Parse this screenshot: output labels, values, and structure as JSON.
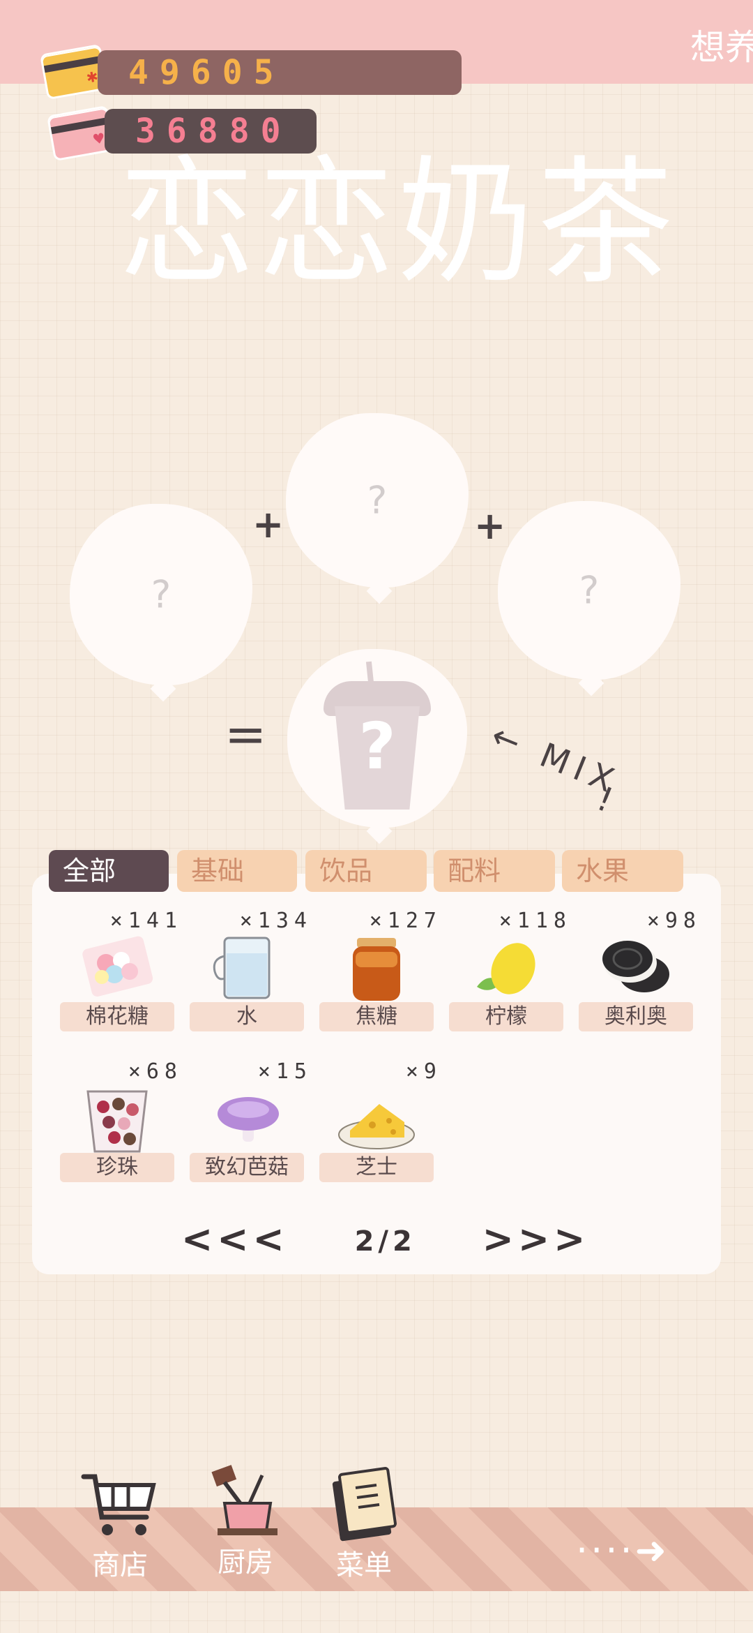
{
  "top_hint": "想养",
  "currency": [
    {
      "value": "49605",
      "icon": "gold-card-icon"
    },
    {
      "value": "36880",
      "icon": "pink-card-icon"
    }
  ],
  "title": "恋恋奶茶",
  "mixer": {
    "slot_mark": "?",
    "plus": "+",
    "equals": "=",
    "result_mark": "?",
    "mix_label": "MIX",
    "mix_bang": "!"
  },
  "tabs": [
    {
      "label": "全部",
      "active": true
    },
    {
      "label": "基础",
      "active": false
    },
    {
      "label": "饮品",
      "active": false
    },
    {
      "label": "配料",
      "active": false
    },
    {
      "label": "水果",
      "active": false
    }
  ],
  "items": [
    {
      "name": "棉花糖",
      "qty": "×141",
      "icon": "marshmallow-icon"
    },
    {
      "name": "水",
      "qty": "×134",
      "icon": "water-icon"
    },
    {
      "name": "焦糖",
      "qty": "×127",
      "icon": "caramel-icon"
    },
    {
      "name": "柠檬",
      "qty": "×118",
      "icon": "lemon-icon"
    },
    {
      "name": "奥利奥",
      "qty": "×98",
      "icon": "oreo-icon"
    },
    {
      "name": "珍珠",
      "qty": "×68",
      "icon": "pearl-icon"
    },
    {
      "name": "致幻芭菇",
      "qty": "×15",
      "icon": "mushroom-icon"
    },
    {
      "name": "芝士",
      "qty": "×9",
      "icon": "cheese-icon"
    }
  ],
  "pager": {
    "prev": "<<<",
    "page": "2/2",
    "next": ">>>"
  },
  "nav": [
    {
      "label": "商店",
      "icon": "cart-icon"
    },
    {
      "label": "厨房",
      "icon": "kitchen-icon"
    },
    {
      "label": "菜单",
      "icon": "menu-book-icon"
    }
  ],
  "next_arrow": "····➜"
}
